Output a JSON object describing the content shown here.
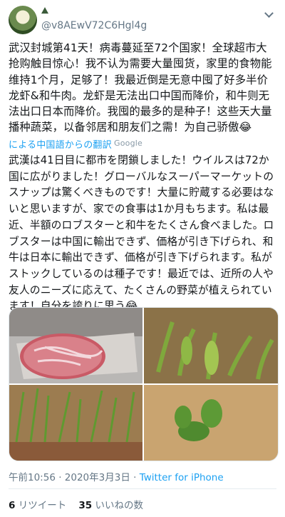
{
  "header": {
    "handle": "@v8AEwV72C6Hgl4g"
  },
  "tweet": {
    "text": "武汉封城第41天！病毒蔓延至72个国家！全球超市大抢购触目惊心！我不认为需要大量囤货，家里的食物能维持1个月，足够了！我最近倒是无意中囤了好多半价龙虾&和牛肉。龙虾是无法出口中国而降价，和牛则无法出口日本而降价。我囤的最多的是种子！这些天大量播种蔬菜，以备邻居和朋友们之需！为自己骄傲😂",
    "translated_label": "による中国語からの翻訳",
    "translator": "Google",
    "translation": "武漢は41日目に都市を閉鎖しました！ウイルスは72か国に広がりました！グローバルなスーパーマーケットのスナップは驚くべきものです！大量に貯蔵する必要はないと思いますが、家での食事は1か月もちます。私は最近、半額のロブスターと和牛をたくさん食べました。ロブスターは中国に輸出できず、価格が引き下げられ、和牛は日本に輸出できず、価格が引き下げられます。私がストックしているのは種子です！最近では、近所の人や友人のニーズに応えて、たくさんの野菜が植えられています！自分を誇りに思う😂"
  },
  "meta": {
    "time": "午前10:56",
    "sep": " · ",
    "date": "2020年3月3日",
    "source": "Twitter for iPhone"
  },
  "stats": {
    "retweets_count": "6",
    "retweets_label": "リツイート",
    "likes_count": "35",
    "likes_label": "いいねの数"
  },
  "icons": {
    "avatar": "avatar-photo",
    "badge": "mountain-icon",
    "menu": "chevron-down-icon"
  },
  "colors": {
    "link": "#1da1f2",
    "secondary": "#657786"
  }
}
